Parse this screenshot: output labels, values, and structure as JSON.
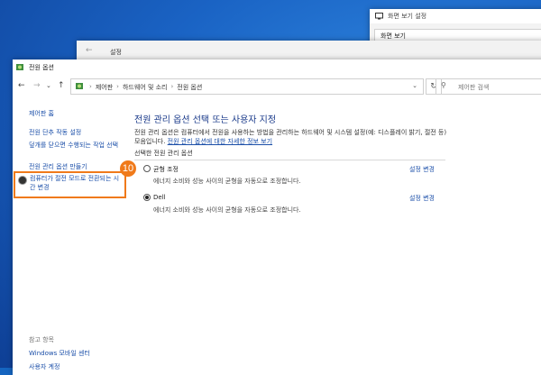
{
  "windows": {
    "display": {
      "title": "화면 보기 설정",
      "tab": "화면 보기"
    },
    "settings": {
      "title": "설정"
    },
    "main": {
      "title": "전원 옵션"
    }
  },
  "address": {
    "crumbs": [
      "제어판",
      "하드웨어 및 소리",
      "전원 옵션"
    ],
    "separator": "›",
    "search_placeholder": "제어판 검색"
  },
  "sidebar": {
    "home": "제어판 홈",
    "items": [
      "전원 단추 작동 설정",
      "덮개를 닫으면 수행되는 작업 선택",
      "전원 관리 옵션 만들기",
      "컴퓨터가 절전 모드로 전환되는 시간 변경"
    ],
    "see_also_header": "참고 항목",
    "see_also": [
      "Windows 모바일 센터",
      "사용자 계정"
    ]
  },
  "main": {
    "heading": "전원 관리 옵션 선택 또는 사용자 지정",
    "description": "전원 관리 옵션은 컴퓨터에서 전원을 사용하는 방법을 관리하는 하드웨어 및 시스템 설정(예: 디스플레이 밝기, 절전 등) 모음입니다.",
    "link": "전원 관리 옵션에 대한 자세한 정보 보기",
    "section": "선택한 전원 관리 옵션",
    "plans": [
      {
        "name": "균형 조정",
        "desc": "에너지 소비와 성능 사이의 균형을 자동으로 조정합니다.",
        "change": "설정 변경",
        "selected": false
      },
      {
        "name": "Dell",
        "desc": "에너지 소비와 성능 사이의 균형을 자동으로 조정합니다.",
        "change": "설정 변경",
        "selected": true
      }
    ]
  },
  "annotation": {
    "step": "10",
    "color": "#f07a1a"
  }
}
